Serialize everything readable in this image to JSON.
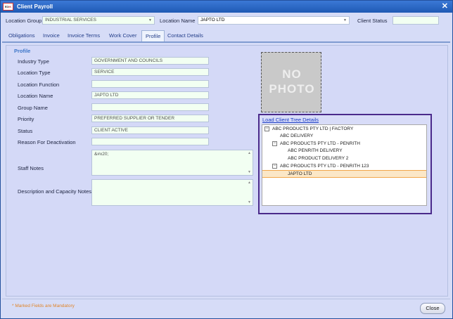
{
  "window": {
    "title": "Client Payroll",
    "close_glyph": "✕",
    "logo_left": "ED",
    "logo_right": "IK"
  },
  "header": {
    "location_group_label": "Location Group",
    "location_group_value": "INDUSTRIAL SERVICES",
    "location_name_label": "Location Name",
    "location_name_value": "JAPTO LTD",
    "client_status_label": "Client Status",
    "client_status_value": ""
  },
  "tabs": [
    "Obligations",
    "Invoice",
    "Invoice Terms",
    "Work Cover",
    "Profile",
    "Contact Details"
  ],
  "active_tab": "Profile",
  "profile": {
    "section_title": "Profile",
    "fields": [
      {
        "label": "Industry Type",
        "value": "GOVERNMENT AND COUNCILS"
      },
      {
        "label": "Location Type",
        "value": "SERVICE"
      },
      {
        "label": "Location  Function",
        "value": ""
      },
      {
        "label": "Location Name",
        "value": "JAPTO LTD"
      },
      {
        "label": "Group Name",
        "value": ""
      },
      {
        "label": "Priority",
        "value": "PREFERRED SUPPLIER OR TENDER"
      },
      {
        "label": "Status",
        "value": "CLIENT ACTIVE"
      },
      {
        "label": "Reason For Deactivation",
        "value": ""
      }
    ],
    "staff_notes_label": "Staff Notes",
    "staff_notes_value": "&#x20;",
    "description_label": "Description  and Capacity Notes",
    "description_value": ""
  },
  "photo": {
    "line1": "NO",
    "line2": "PHOTO"
  },
  "tree": {
    "link_label": "Load Client Tree Details",
    "nodes": [
      {
        "label": "ABC PRODUCTS PTY LTD | FACTORY",
        "toggle": "−",
        "selected": false
      },
      {
        "label": "ABC DELIVERY",
        "toggle": "",
        "selected": false
      },
      {
        "label": "ABC PRODUCTS PTY LTD - PENRITH",
        "toggle": "−",
        "selected": false
      },
      {
        "label": "ABC PENRITH DELIVERY",
        "toggle": "",
        "selected": false
      },
      {
        "label": "ABC PRODUCT DELIVERY 2",
        "toggle": "",
        "selected": false
      },
      {
        "label": "ABC PRODUCTS PTY LTD - PENRITH 123",
        "toggle": "−",
        "selected": false
      },
      {
        "label": "JAPTO LTD",
        "toggle": "",
        "selected": true
      }
    ]
  },
  "footer": {
    "mandatory_note": "* Marked Fields are Mandatory",
    "close_label": "Close"
  },
  "icons": {
    "dropdown": "▼",
    "scroll_up": "▲",
    "scroll_down": "▼"
  },
  "colors": {
    "titlebar": "#1f59b4",
    "accent_link": "#1e3fc4",
    "tree_border": "#4a2a8b",
    "mandatory": "#e0852b",
    "selected_row": "#fbe7c7"
  }
}
